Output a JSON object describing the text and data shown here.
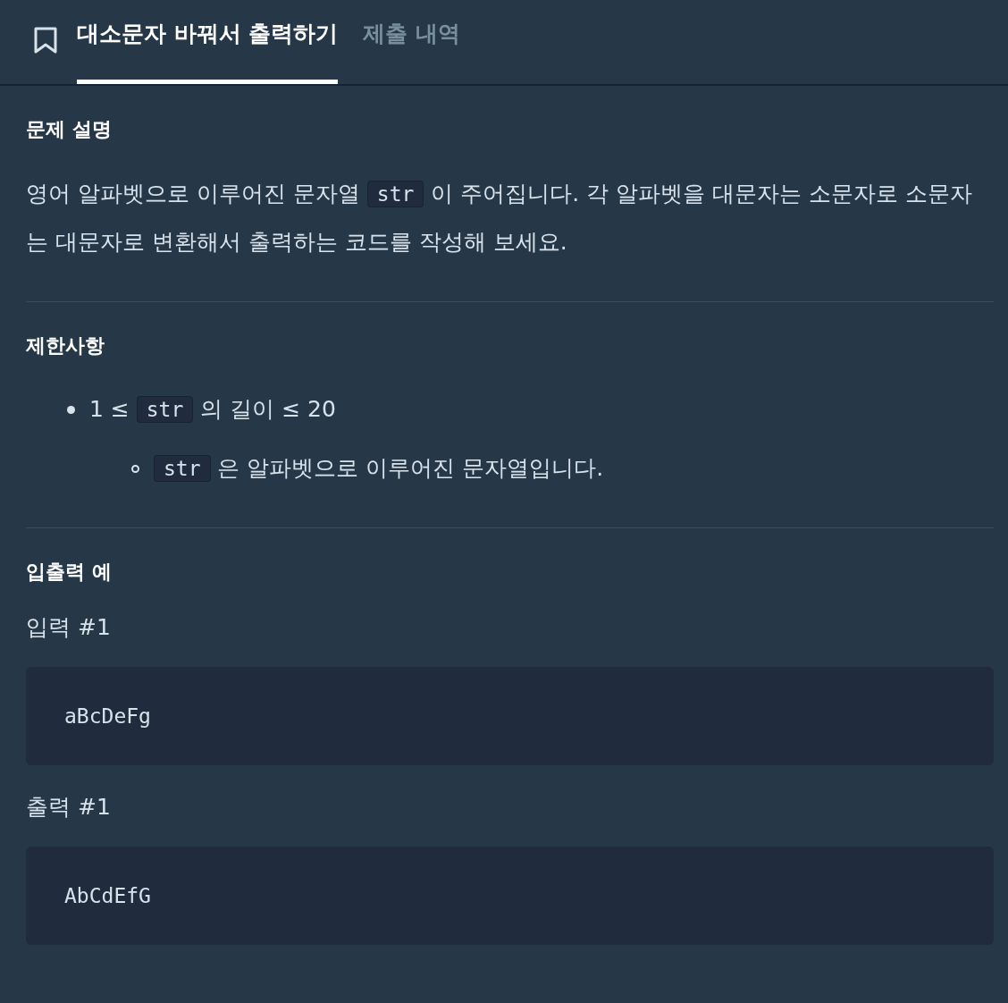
{
  "tabs": [
    {
      "label": "대소문자 바꿔서 출력하기",
      "selected": true
    },
    {
      "label": "제출 내역",
      "selected": false
    }
  ],
  "sections": [
    {
      "heading": "문제 설명",
      "blocks": [
        {
          "kind": "paragraph",
          "parts": [
            {
              "kind": "text",
              "text": "영어 알파벳으로 이루어진 문자열 "
            },
            {
              "kind": "code",
              "text": "str"
            },
            {
              "kind": "text",
              "text": " 이 주어집니다. 각 알파벳을 대문자는 소문자로 소문자는 대문자로 변환해서 출력하는 코드를 작성해 보세요."
            }
          ]
        }
      ]
    },
    {
      "heading": "제한사항",
      "blocks": [
        {
          "kind": "list",
          "items": [
            {
              "parts": [
                {
                  "kind": "text",
                  "text": "1 ≤ "
                },
                {
                  "kind": "code",
                  "text": "str"
                },
                {
                  "kind": "text",
                  "text": " 의 길이 ≤ 20"
                }
              ],
              "children": [
                {
                  "parts": [
                    {
                      "kind": "code",
                      "text": "str"
                    },
                    {
                      "kind": "text",
                      "text": " 은 알파벳으로 이루어진 문자열입니다."
                    }
                  ]
                }
              ]
            }
          ]
        }
      ]
    },
    {
      "heading": "입출력 예",
      "blocks": [
        {
          "kind": "example",
          "label": "입력 #1",
          "code": "aBcDeFg"
        },
        {
          "kind": "example",
          "label": "출력 #1",
          "code": "AbCdEfG"
        }
      ]
    }
  ]
}
